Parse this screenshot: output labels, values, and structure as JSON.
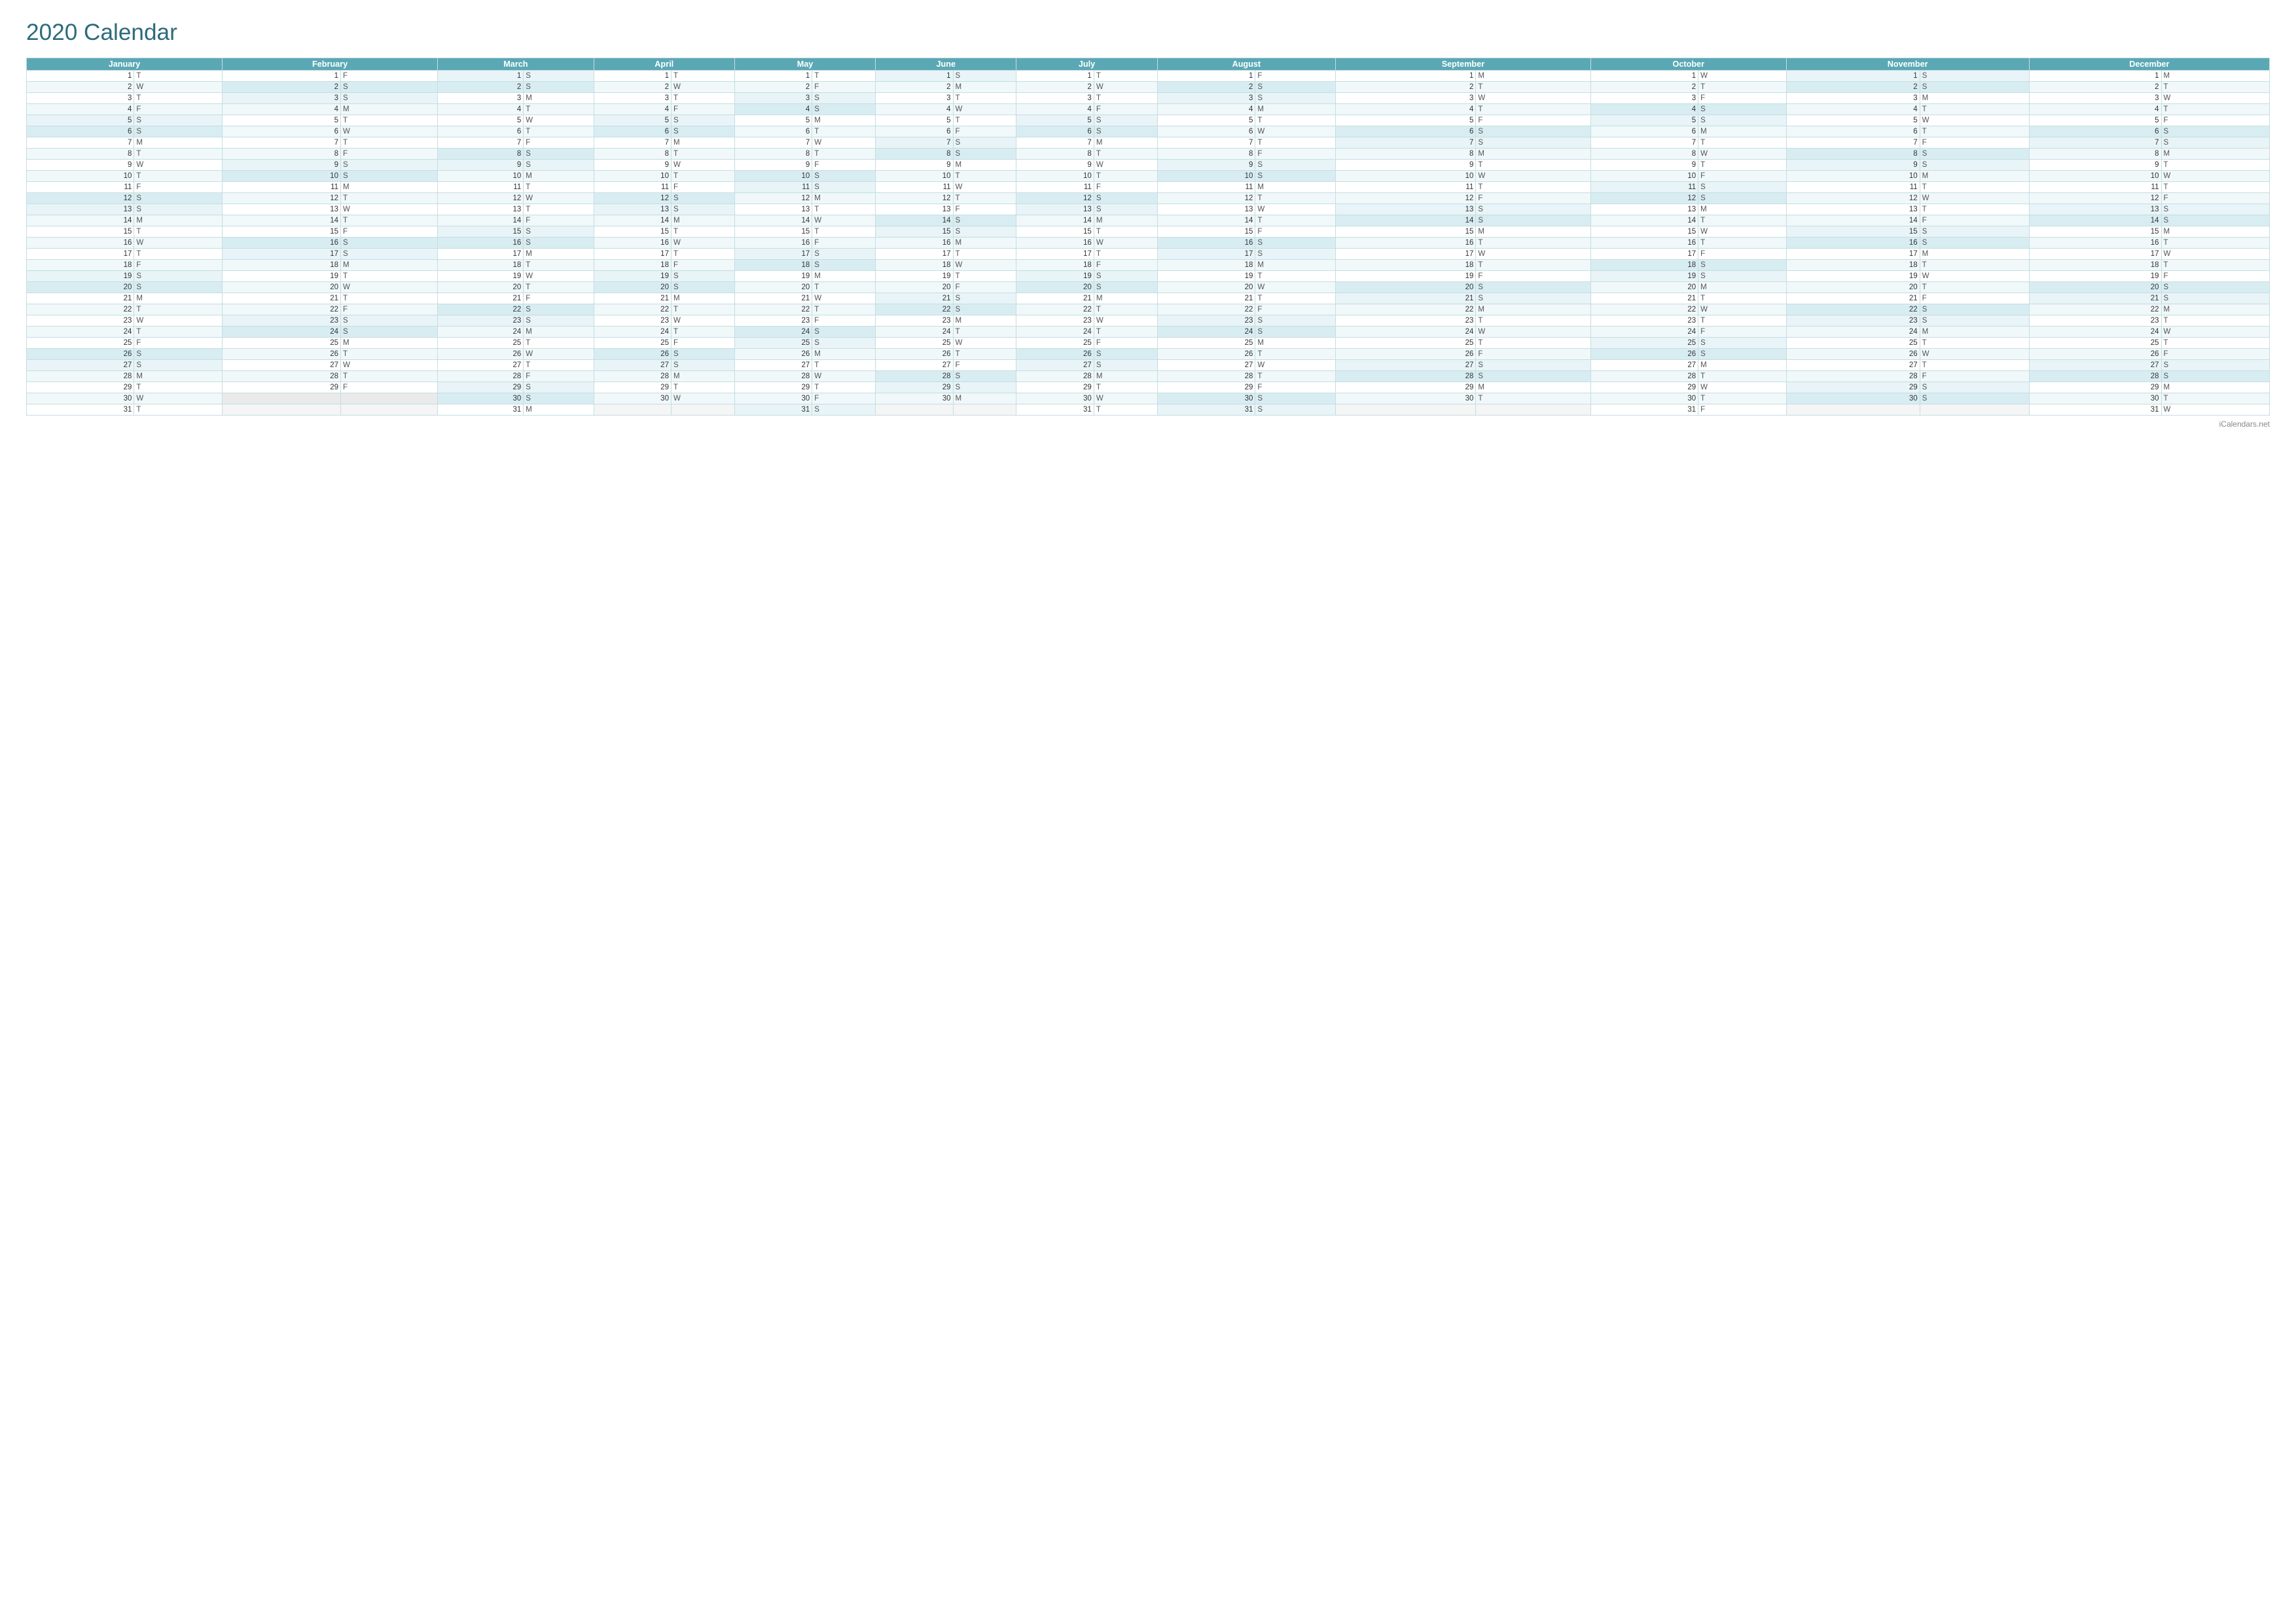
{
  "title": "2020 Calendar",
  "footer": "iCalendars.net",
  "months": [
    {
      "name": "January",
      "days": 31,
      "startDay": 2
    },
    {
      "name": "February",
      "days": 29,
      "startDay": 5
    },
    {
      "name": "March",
      "days": 31,
      "startDay": 6
    },
    {
      "name": "April",
      "days": 30,
      "startDay": 2
    },
    {
      "name": "May",
      "days": 31,
      "startDay": 4
    },
    {
      "name": "June",
      "days": 30,
      "startDay": 0
    },
    {
      "name": "July",
      "days": 31,
      "startDay": 2
    },
    {
      "name": "August",
      "days": 31,
      "startDay": 5
    },
    {
      "name": "September",
      "days": 30,
      "startDay": 1
    },
    {
      "name": "October",
      "days": 31,
      "startDay": 3
    },
    {
      "name": "November",
      "days": 30,
      "startDay": 6
    },
    {
      "name": "December",
      "days": 31,
      "startDay": 1
    }
  ],
  "dayLetters": [
    "S",
    "M",
    "T",
    "W",
    "T",
    "F",
    "S"
  ]
}
